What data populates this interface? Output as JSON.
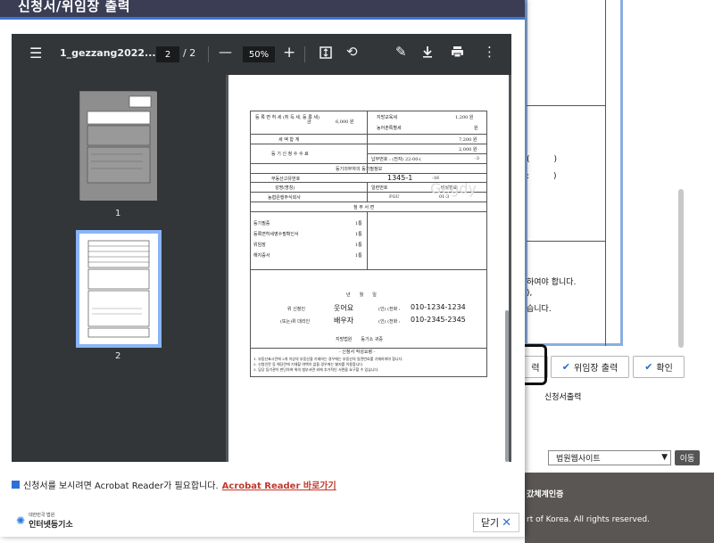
{
  "modal": {
    "title": "신청서/위임장 출력",
    "close_label": "닫기"
  },
  "viewer": {
    "file_name": "1_gezzang2022...",
    "current_page": "2",
    "page_sep": "/",
    "total_pages": "2",
    "zoom": "50%",
    "thumbnails": [
      {
        "label": "1"
      },
      {
        "label": "2"
      }
    ]
  },
  "document": {
    "fee_label": "등 록 면 허 세\n(취 득 세, 등 록 세)",
    "fee_won_label": "금",
    "fee_amount": "6,000 원",
    "local_edu_tax_label": "지방교육세",
    "local_edu_tax_amount": "1,200 원",
    "rural_tax_label": "농어촌특별세",
    "rural_tax_amount": "원",
    "total_label": "세 액 합 계",
    "total_amount": "7,200 원",
    "reg_fee_label": "등 기 신 청 수 수 료",
    "reg_fee_amount": "2,000 원",
    "payment_no": "납부번호 : (전자) 22-00-(",
    "payment_suffix": "-3",
    "obligation_info": "등기의무자의 등기필정보",
    "property_no_label": "부동산고유번호",
    "property_no": "1345-1",
    "property_no_suffix": "-16",
    "name_label": "성명(명칭)",
    "serial_label": "일련번호",
    "password_label": "비밀번호",
    "name_value": "농협은행주식회사",
    "serial_value": "FGU",
    "password_value": "01-3",
    "watermark": "Gegdy",
    "attachments_title": "첨 부 서 면",
    "attachments": [
      {
        "name": "등기필증",
        "count": "1통"
      },
      {
        "name": "등록면허세영수필확인서",
        "count": "1통"
      },
      {
        "name": "위임장",
        "count": "1통"
      },
      {
        "name": "해지증서",
        "count": "1통"
      }
    ],
    "date_line": "년　　월　　일",
    "applicant_label": "위 신청인",
    "applicant_name": "웃어요",
    "applicant_phone_label": "(인) (전화 :",
    "applicant_phone": "010-1234-1234",
    "agent_label": "(또는)위 대리인",
    "agent_name": "배우자",
    "agent_phone_label": "(인) (전화 :",
    "agent_phone": "010-2345-2345",
    "court_line": "지방법원　　등기소 귀중",
    "notes_title": "- 신청서 작성요령 -",
    "notes": [
      "1. 부동산표시란에 2개 이상의 부동산을 기재하는 경우에는 부동산의 일련번호를 기재하여야 합니다.",
      "2. 신청인란 등 해당란에 기재할 여백이 없을 경우에는 별지를 이용합니다.",
      "3. 담당 등기관이 판단하여 위의 첨부서면 외에 추가적인 서면을 요구할 수 있습니다."
    ]
  },
  "notice": {
    "text": "신청서를 보시려면 Acrobat Reader가 필요합니다.",
    "link": "Acrobat Reader 바로가기"
  },
  "logo": {
    "line1": "대한민국 법원",
    "line2": "인터넷등기소"
  },
  "background": {
    "paren1": "(　　　)",
    "paren2": ":　　　)",
    "text1": "하여야 합니다.",
    "text2": "),",
    "text3": "습니다.",
    "btn_print_partial": "력",
    "btn_power_of_attorney": "위임장 출력",
    "btn_confirm": "확인",
    "caption": "신청서출력",
    "select_value": "법원웹사이트",
    "go_label": "이동",
    "footer_line1": "갔체계인증",
    "footer_line2": "rt of Korea. All rights reserved."
  },
  "colors": {
    "header_bg": "#3b3d55",
    "header_accent": "#3b76d3",
    "viewer_toolbar": "#323639",
    "link_red": "#c0392b",
    "footer_bg": "#5a5654"
  }
}
